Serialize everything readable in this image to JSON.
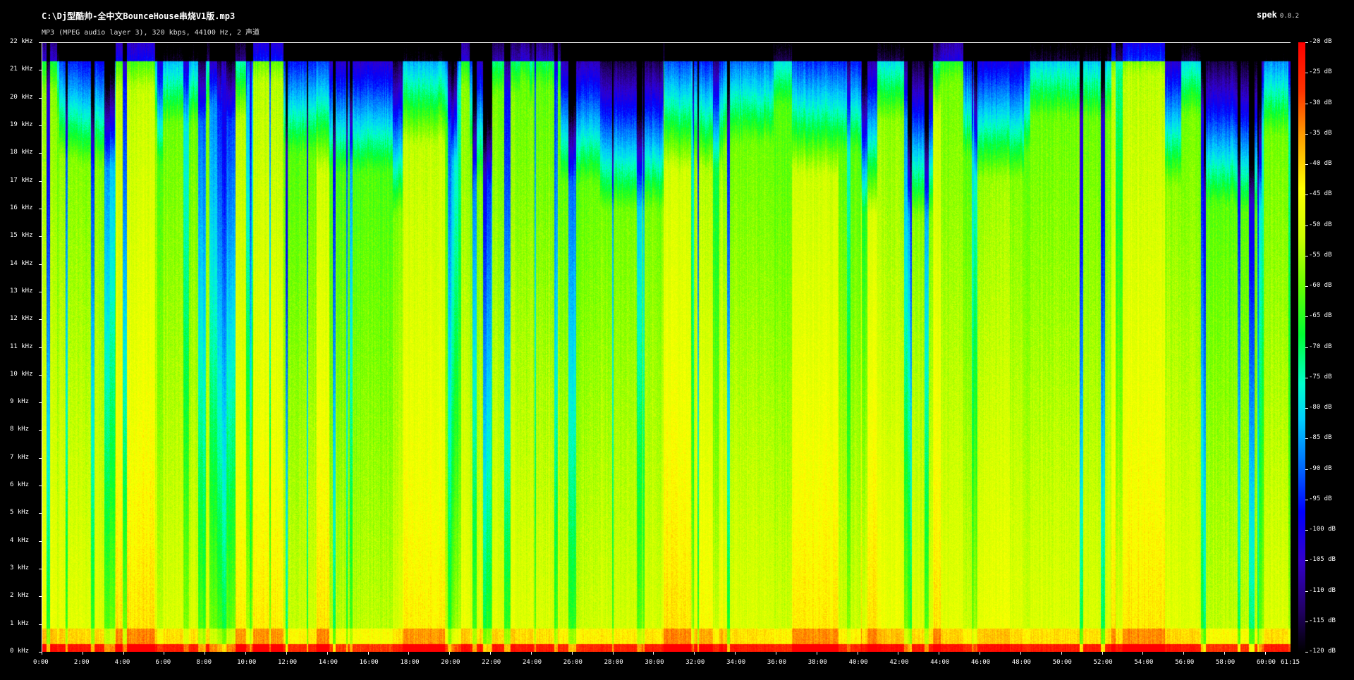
{
  "header": {
    "file_path": "C:\\Dj型酷帅-全中文BounceHouse串烧V1版.mp3",
    "file_info": "MP3 (MPEG audio layer 3), 320 kbps, 44100 Hz, 2 声道",
    "app_name": "spek",
    "app_version": "0.8.2"
  },
  "frequency_axis": {
    "labels": [
      "22 kHz",
      "21 kHz",
      "20 kHz",
      "19 kHz",
      "18 kHz",
      "17 kHz",
      "16 kHz",
      "15 kHz",
      "14 kHz",
      "13 kHz",
      "12 kHz",
      "11 kHz",
      "10 kHz",
      "9 kHz",
      "8 kHz",
      "7 kHz",
      "6 kHz",
      "5 kHz",
      "4 kHz",
      "3 kHz",
      "2 kHz",
      "1 kHz",
      "0 kHz"
    ]
  },
  "time_axis": {
    "labels": [
      "0:00",
      "2:00",
      "4:00",
      "6:00",
      "8:00",
      "10:00",
      "12:00",
      "14:00",
      "16:00",
      "18:00",
      "20:00",
      "22:00",
      "24:00",
      "26:00",
      "28:00",
      "30:00",
      "32:00",
      "34:00",
      "36:00",
      "38:00",
      "40:00",
      "42:00",
      "44:00",
      "46:00",
      "48:00",
      "50:00",
      "52:00",
      "54:00",
      "56:00",
      "58:00",
      "60:00"
    ],
    "end_label": "61:15"
  },
  "legend": {
    "labels": [
      "-20 dB",
      "-25 dB",
      "-30 dB",
      "-35 dB",
      "-40 dB",
      "-45 dB",
      "-50 dB",
      "-55 dB",
      "-60 dB",
      "-65 dB",
      "-70 dB",
      "-75 dB",
      "-80 dB",
      "-85 dB",
      "-90 dB",
      "-95 dB",
      "-100 dB",
      "-105 dB",
      "-110 dB",
      "-115 dB",
      "-120 dB"
    ]
  }
}
